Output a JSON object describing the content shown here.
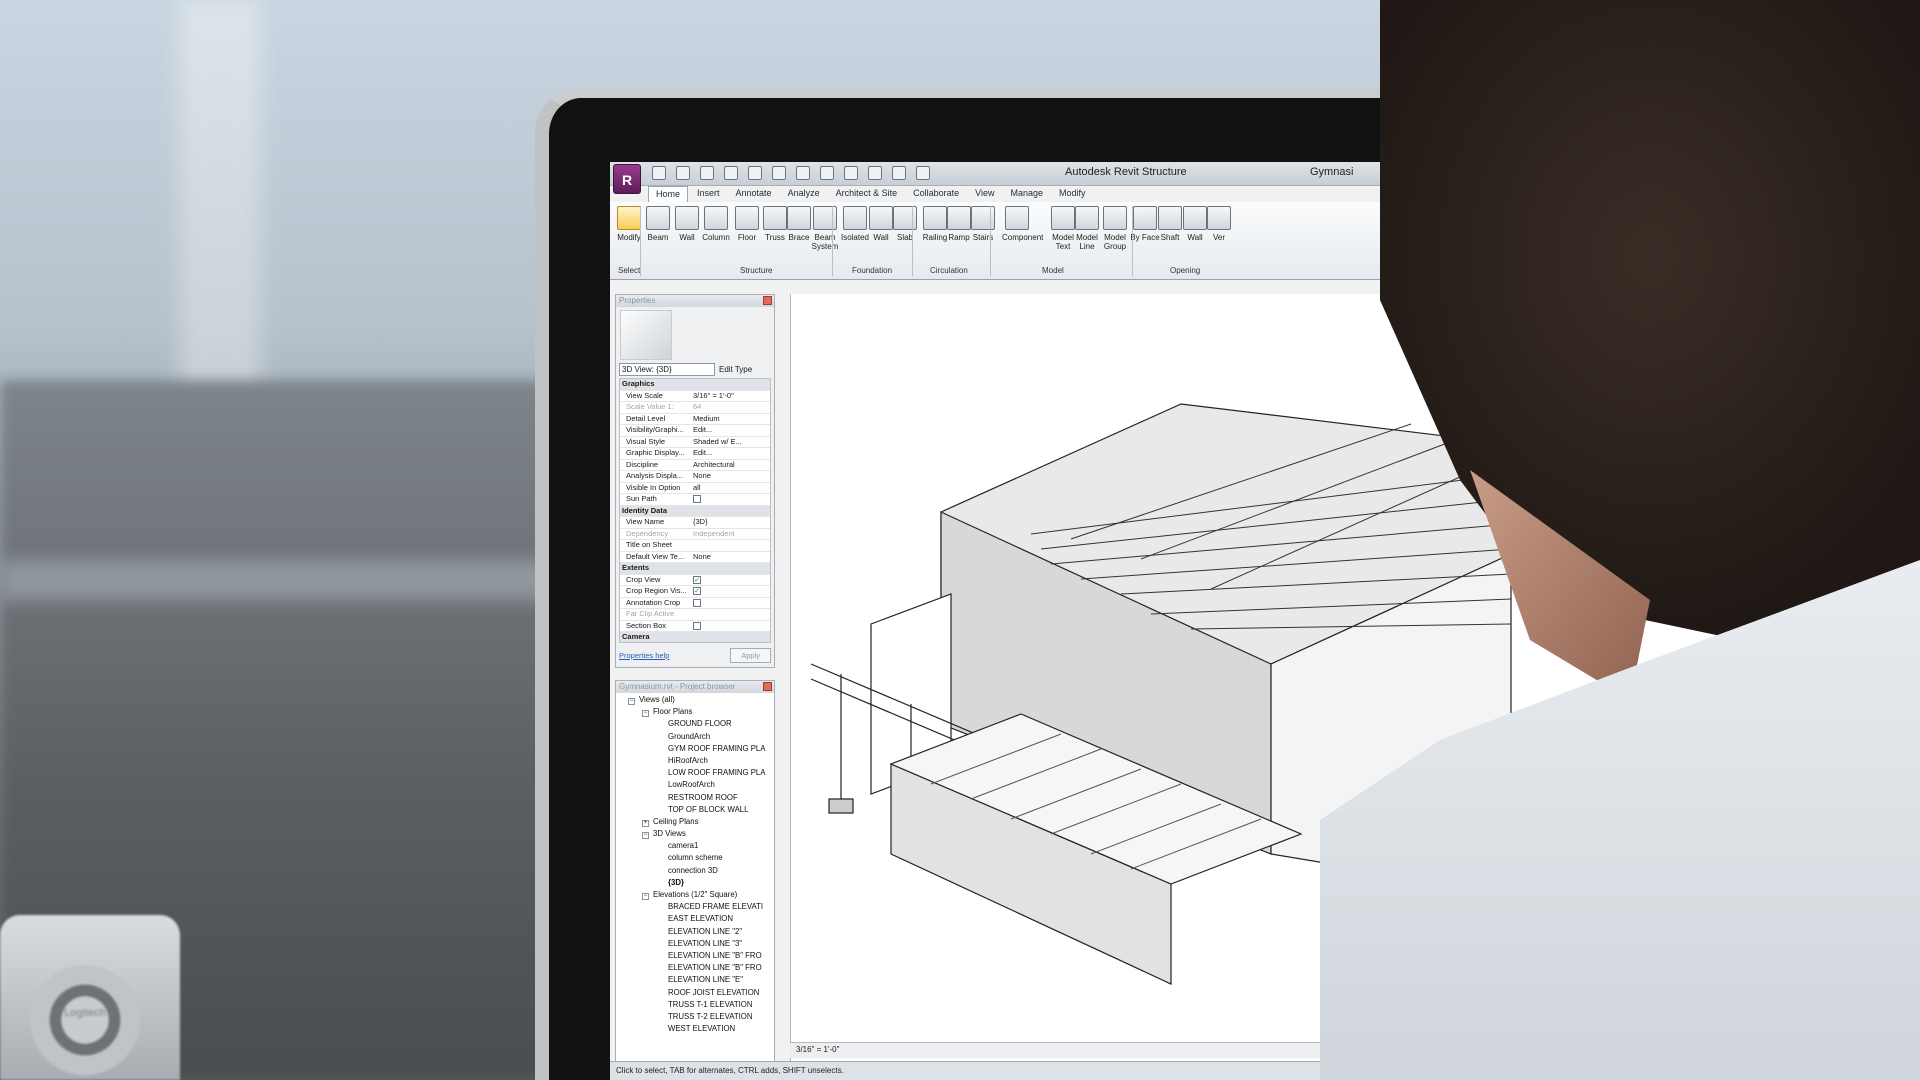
{
  "window": {
    "title": "Autodesk Revit Structure",
    "project_partial": "Gymnasi"
  },
  "tabs": [
    "Home",
    "Insert",
    "Annotate",
    "Analyze",
    "Architect & Site",
    "Collaborate",
    "View",
    "Manage",
    "Modify"
  ],
  "ribbon": {
    "buttons": [
      {
        "label": "Modify",
        "icon": "cursor-icon"
      },
      {
        "label": "Beam",
        "icon": "beam-icon"
      },
      {
        "label": "Wall",
        "icon": "wall-icon"
      },
      {
        "label": "Column",
        "icon": "column-icon"
      },
      {
        "label": "Floor",
        "icon": "floor-icon"
      },
      {
        "label": "Truss",
        "icon": "truss-icon"
      },
      {
        "label": "Brace",
        "icon": "brace-icon"
      },
      {
        "label": "Beam System",
        "icon": "beam-system-icon"
      },
      {
        "label": "Isolated",
        "icon": "isolated-icon"
      },
      {
        "label": "Wall",
        "icon": "wall-foundation-icon"
      },
      {
        "label": "Slab",
        "icon": "slab-icon"
      },
      {
        "label": "Railing",
        "icon": "railing-icon"
      },
      {
        "label": "Ramp",
        "icon": "ramp-icon"
      },
      {
        "label": "Stairs",
        "icon": "stairs-icon"
      },
      {
        "label": "Component",
        "icon": "component-icon"
      },
      {
        "label": "Model Text",
        "icon": "model-text-icon"
      },
      {
        "label": "Model Line",
        "icon": "model-line-icon"
      },
      {
        "label": "Model Group",
        "icon": "model-group-icon"
      },
      {
        "label": "By Face",
        "icon": "by-face-icon"
      },
      {
        "label": "Shaft",
        "icon": "shaft-icon"
      },
      {
        "label": "Wall",
        "icon": "wall-opening-icon"
      },
      {
        "label": "Ver",
        "icon": "vertical-icon"
      }
    ],
    "groups": [
      "Select",
      "Structure",
      "Foundation",
      "Circulation",
      "Model",
      "Opening"
    ]
  },
  "properties": {
    "header": "Properties",
    "type_selector": "3D View: {3D}",
    "edit_type": "Edit Type",
    "rows": [
      {
        "k": "Graphics",
        "v": "",
        "sec": true
      },
      {
        "k": "View Scale",
        "v": "3/16\" = 1'-0\""
      },
      {
        "k": "Scale Value 1:",
        "v": "64",
        "dim": true
      },
      {
        "k": "Detail Level",
        "v": "Medium"
      },
      {
        "k": "Visibility/Graphi...",
        "v": "Edit..."
      },
      {
        "k": "Visual Style",
        "v": "Shaded w/ E..."
      },
      {
        "k": "Graphic Display...",
        "v": "Edit..."
      },
      {
        "k": "Discipline",
        "v": "Architectural"
      },
      {
        "k": "Analysis Displa...",
        "v": "None"
      },
      {
        "k": "Visible In Option",
        "v": "all"
      },
      {
        "k": "Sun Path",
        "v": "",
        "cb": false
      },
      {
        "k": "Identity Data",
        "v": "",
        "sec": true
      },
      {
        "k": "View Name",
        "v": "{3D}"
      },
      {
        "k": "Dependency",
        "v": "Independent",
        "dim": true
      },
      {
        "k": "Title on Sheet",
        "v": ""
      },
      {
        "k": "Default View Te...",
        "v": "None"
      },
      {
        "k": "Extents",
        "v": "",
        "sec": true
      },
      {
        "k": "Crop View",
        "v": "",
        "cb": true
      },
      {
        "k": "Crop Region Vis...",
        "v": "",
        "cb": true
      },
      {
        "k": "Annotation Crop",
        "v": "",
        "cb": false
      },
      {
        "k": "Far Clip Active",
        "v": "",
        "dim": true
      },
      {
        "k": "Section Box",
        "v": "",
        "cb": false
      },
      {
        "k": "Camera",
        "v": "",
        "sec": true
      }
    ],
    "help": "Properties help",
    "apply": "Apply"
  },
  "browser": {
    "header": "Gymnasium.rvt - Project browser",
    "items": [
      {
        "t": "Views (all)",
        "l": "l1",
        "tg": "−"
      },
      {
        "t": "Floor Plans",
        "l": "l2",
        "tg": "−"
      },
      {
        "t": "GROUND FLOOR",
        "l": "l3"
      },
      {
        "t": "GroundArch",
        "l": "l3"
      },
      {
        "t": "GYM ROOF FRAMING PLA",
        "l": "l3"
      },
      {
        "t": "HiRoofArch",
        "l": "l3"
      },
      {
        "t": "LOW ROOF FRAMING PLA",
        "l": "l3"
      },
      {
        "t": "LowRoofArch",
        "l": "l3"
      },
      {
        "t": "RESTROOM ROOF",
        "l": "l3"
      },
      {
        "t": "TOP OF BLOCK WALL",
        "l": "l3"
      },
      {
        "t": "Ceiling Plans",
        "l": "l2",
        "tg": "+"
      },
      {
        "t": "3D Views",
        "l": "l2",
        "tg": "−"
      },
      {
        "t": "camera1",
        "l": "l3"
      },
      {
        "t": "column scheme",
        "l": "l3"
      },
      {
        "t": "connection 3D",
        "l": "l3"
      },
      {
        "t": "{3D}",
        "l": "l3",
        "bold": true
      },
      {
        "t": "Elevations (1/2\" Square)",
        "l": "l2",
        "tg": "−"
      },
      {
        "t": "BRACED FRAME ELEVATI",
        "l": "l3"
      },
      {
        "t": "EAST ELEVATION",
        "l": "l3"
      },
      {
        "t": "ELEVATION LINE \"2\"",
        "l": "l3"
      },
      {
        "t": "ELEVATION LINE \"3\"",
        "l": "l3"
      },
      {
        "t": "ELEVATION LINE \"B\" FRO",
        "l": "l3"
      },
      {
        "t": "ELEVATION LINE \"B\" FRO",
        "l": "l3"
      },
      {
        "t": "ELEVATION LINE \"E\"",
        "l": "l3"
      },
      {
        "t": "ROOF JOIST ELEVATION",
        "l": "l3"
      },
      {
        "t": "TRUSS T-1 ELEVATION",
        "l": "l3"
      },
      {
        "t": "TRUSS T-2 ELEVATION",
        "l": "l3"
      },
      {
        "t": "WEST ELEVATION",
        "l": "l3"
      }
    ]
  },
  "view_status": "3/16\" = 1'-0\"",
  "status": "Click to select, TAB for alternates, CTRL adds, SHIFT unselects.",
  "speaker_brand": "Logitech"
}
